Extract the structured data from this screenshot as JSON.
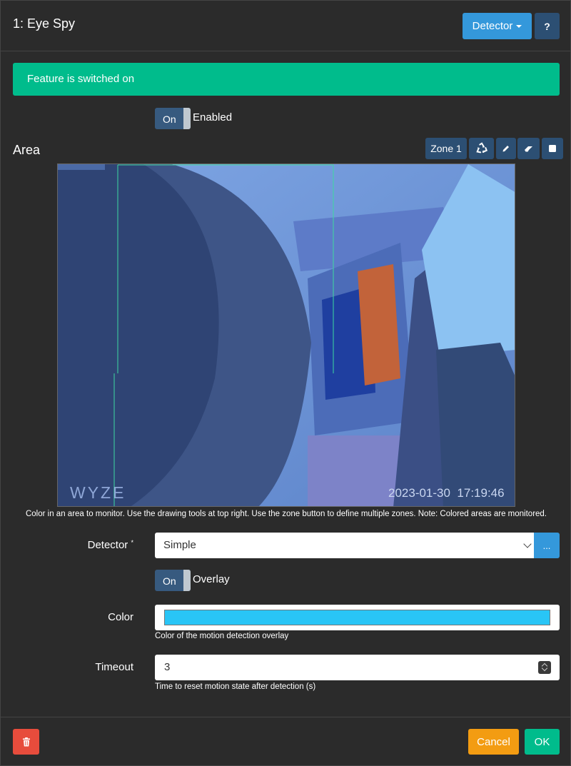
{
  "header": {
    "title": "1: Eye Spy",
    "detector_button": "Detector",
    "help_button": "?"
  },
  "alert": {
    "text": "Feature is switched on"
  },
  "enabled_toggle": {
    "state": "On",
    "label": "Enabled"
  },
  "area": {
    "title": "Area",
    "zone_button": "Zone 1",
    "help": "Color in an area to monitor. Use the drawing tools at top right. Use the zone button to define multiple zones. Note: Colored areas are monitored.",
    "camera": {
      "watermark": "WYZE",
      "timestamp": "2023-01-30  17:19:46"
    }
  },
  "form": {
    "detector": {
      "label": "Detector",
      "required_mark": "*",
      "value": "Simple",
      "more_button": "..."
    },
    "overlay_toggle": {
      "state": "On",
      "label": "Overlay"
    },
    "color": {
      "label": "Color",
      "value": "#29c5f6",
      "help": "Color of the motion detection overlay"
    },
    "timeout": {
      "label": "Timeout",
      "value": "3",
      "help": "Time to reset motion state after detection (s)"
    }
  },
  "footer": {
    "cancel_button": "Cancel",
    "ok_button": "OK"
  },
  "colors": {
    "background": "#2b2b2b",
    "primary": "#3498db",
    "secondary": "#2c4f73",
    "success": "#00bc8c",
    "warning": "#f39c12",
    "danger": "#e74c3c",
    "overlay": "#29c5f6"
  }
}
